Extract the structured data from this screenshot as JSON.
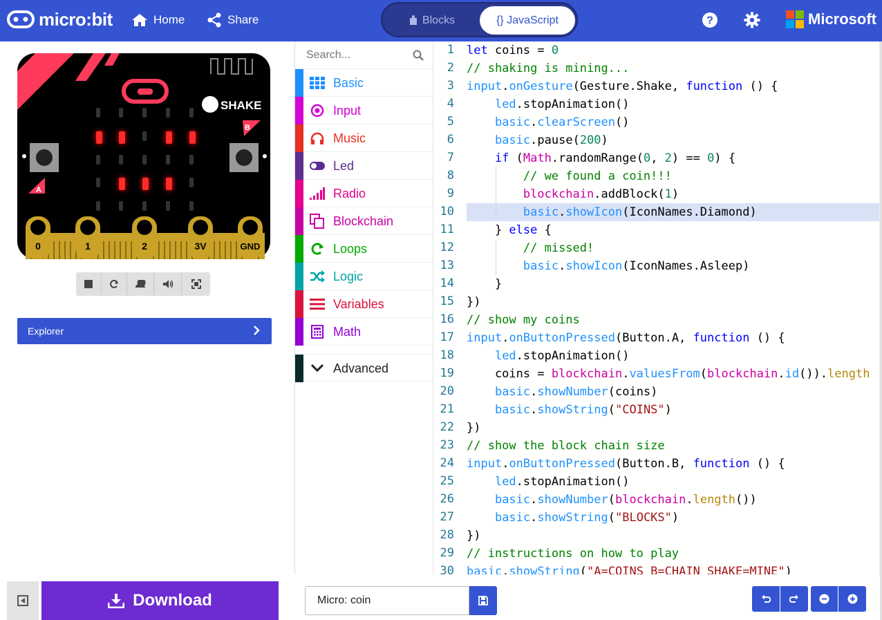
{
  "header": {
    "brand": "micro:bit",
    "home_label": "Home",
    "share_label": "Share",
    "tabs": {
      "blocks": "Blocks",
      "javascript": "{} JavaScript"
    },
    "ms_brand": "Microsoft"
  },
  "simulator": {
    "shake_label": "SHAKE",
    "button_a": "A",
    "button_b": "B",
    "pins": [
      "0",
      "1",
      "2",
      "3V",
      "GND"
    ],
    "explorer_label": "Explorer"
  },
  "toolbox": {
    "search_placeholder": "Search...",
    "categories": [
      {
        "label": "Basic",
        "color": "#1e90ff",
        "icon": "grid-icon"
      },
      {
        "label": "Input",
        "color": "#d400d4",
        "icon": "target-icon"
      },
      {
        "label": "Music",
        "color": "#e63022",
        "icon": "headphones-icon"
      },
      {
        "label": "Led",
        "color": "#5c2d91",
        "icon": "toggle-icon"
      },
      {
        "label": "Radio",
        "color": "#e3008c",
        "icon": "signal-bars-icon"
      },
      {
        "label": "Blockchain",
        "color": "#c800a4",
        "icon": "copy-icon"
      },
      {
        "label": "Loops",
        "color": "#00aa00",
        "icon": "refresh-icon"
      },
      {
        "label": "Logic",
        "color": "#00a4a6",
        "icon": "shuffle-icon"
      },
      {
        "label": "Variables",
        "color": "#dc143c",
        "icon": "list-icon"
      },
      {
        "label": "Math",
        "color": "#9400d3",
        "icon": "calculator-icon"
      }
    ],
    "advanced_label": "Advanced"
  },
  "code": {
    "highlight_line": 10,
    "lines": [
      [
        [
          "let ",
          "kw"
        ],
        [
          "coins ",
          "tx"
        ],
        [
          "= ",
          "tx"
        ],
        [
          "0",
          "num"
        ]
      ],
      [
        [
          "// shaking is mining...",
          "cm"
        ]
      ],
      [
        [
          "input",
          "ns"
        ],
        [
          ".",
          "tx"
        ],
        [
          "onGesture",
          "fn"
        ],
        [
          "(Gesture.Shake, ",
          "tx"
        ],
        [
          "function",
          "kw"
        ],
        [
          " () {",
          "tx"
        ]
      ],
      [
        [
          "    ",
          "tx"
        ],
        [
          "led",
          "ns"
        ],
        [
          ".",
          "tx"
        ],
        [
          "stopAnimation",
          "tx"
        ],
        [
          "()",
          "tx"
        ]
      ],
      [
        [
          "    ",
          "tx"
        ],
        [
          "basic",
          "ns"
        ],
        [
          ".",
          "tx"
        ],
        [
          "clearScreen",
          "fn"
        ],
        [
          "()",
          "tx"
        ]
      ],
      [
        [
          "    ",
          "tx"
        ],
        [
          "basic",
          "ns"
        ],
        [
          ".",
          "tx"
        ],
        [
          "pause",
          "tx"
        ],
        [
          "(",
          "tx"
        ],
        [
          "200",
          "num"
        ],
        [
          ")",
          "tx"
        ]
      ],
      [
        [
          "    ",
          "tx"
        ],
        [
          "if",
          "kw"
        ],
        [
          " (",
          "tx"
        ],
        [
          "Math",
          "cls"
        ],
        [
          ".randomRange(",
          "tx"
        ],
        [
          "0",
          "num"
        ],
        [
          ", ",
          "tx"
        ],
        [
          "2",
          "num"
        ],
        [
          ") == ",
          "tx"
        ],
        [
          "0",
          "num"
        ],
        [
          ") {",
          "tx"
        ]
      ],
      [
        [
          "        ",
          "tx"
        ],
        [
          "// we found a coin!!!",
          "cm"
        ]
      ],
      [
        [
          "        ",
          "tx"
        ],
        [
          "blockchain",
          "cls"
        ],
        [
          ".",
          "tx"
        ],
        [
          "addBlock",
          "tx"
        ],
        [
          "(",
          "tx"
        ],
        [
          "1",
          "num"
        ],
        [
          ")",
          "tx"
        ]
      ],
      [
        [
          "        ",
          "tx"
        ],
        [
          "basic",
          "ns"
        ],
        [
          ".",
          "tx"
        ],
        [
          "showIcon",
          "fn"
        ],
        [
          "(IconNames.Diamond)",
          "tx"
        ]
      ],
      [
        [
          "    } ",
          "tx"
        ],
        [
          "else",
          "kw"
        ],
        [
          " {",
          "tx"
        ]
      ],
      [
        [
          "        ",
          "tx"
        ],
        [
          "// missed!",
          "cm"
        ]
      ],
      [
        [
          "        ",
          "tx"
        ],
        [
          "basic",
          "ns"
        ],
        [
          ".",
          "tx"
        ],
        [
          "showIcon",
          "fn"
        ],
        [
          "(IconNames.Asleep)",
          "tx"
        ]
      ],
      [
        [
          "    }",
          "tx"
        ]
      ],
      [
        [
          "})",
          "tx"
        ]
      ],
      [
        [
          "// show my coins",
          "cm"
        ]
      ],
      [
        [
          "input",
          "ns"
        ],
        [
          ".",
          "tx"
        ],
        [
          "onButtonPressed",
          "fn"
        ],
        [
          "(Button.A, ",
          "tx"
        ],
        [
          "function",
          "kw"
        ],
        [
          " () {",
          "tx"
        ]
      ],
      [
        [
          "    ",
          "tx"
        ],
        [
          "led",
          "ns"
        ],
        [
          ".",
          "tx"
        ],
        [
          "stopAnimation",
          "tx"
        ],
        [
          "()",
          "tx"
        ]
      ],
      [
        [
          "    coins = ",
          "tx"
        ],
        [
          "blockchain",
          "cls"
        ],
        [
          ".",
          "tx"
        ],
        [
          "valuesFrom",
          "fn"
        ],
        [
          "(",
          "tx"
        ],
        [
          "blockchain",
          "cls"
        ],
        [
          ".",
          "tx"
        ],
        [
          "id",
          "fn"
        ],
        [
          "()).",
          "tx"
        ],
        [
          "length",
          "prop"
        ]
      ],
      [
        [
          "    ",
          "tx"
        ],
        [
          "basic",
          "ns"
        ],
        [
          ".",
          "tx"
        ],
        [
          "showNumber",
          "fn"
        ],
        [
          "(coins)",
          "tx"
        ]
      ],
      [
        [
          "    ",
          "tx"
        ],
        [
          "basic",
          "ns"
        ],
        [
          ".",
          "tx"
        ],
        [
          "showString",
          "fn"
        ],
        [
          "(",
          "tx"
        ],
        [
          "\"COINS\"",
          "str"
        ],
        [
          ")",
          "tx"
        ]
      ],
      [
        [
          "})",
          "tx"
        ]
      ],
      [
        [
          "// show the block chain size",
          "cm"
        ]
      ],
      [
        [
          "input",
          "ns"
        ],
        [
          ".",
          "tx"
        ],
        [
          "onButtonPressed",
          "fn"
        ],
        [
          "(Button.B, ",
          "tx"
        ],
        [
          "function",
          "kw"
        ],
        [
          " () {",
          "tx"
        ]
      ],
      [
        [
          "    ",
          "tx"
        ],
        [
          "led",
          "ns"
        ],
        [
          ".",
          "tx"
        ],
        [
          "stopAnimation",
          "tx"
        ],
        [
          "()",
          "tx"
        ]
      ],
      [
        [
          "    ",
          "tx"
        ],
        [
          "basic",
          "ns"
        ],
        [
          ".",
          "tx"
        ],
        [
          "showNumber",
          "fn"
        ],
        [
          "(",
          "tx"
        ],
        [
          "blockchain",
          "cls"
        ],
        [
          ".",
          "tx"
        ],
        [
          "length",
          "prop"
        ],
        [
          "())",
          "tx"
        ]
      ],
      [
        [
          "    ",
          "tx"
        ],
        [
          "basic",
          "ns"
        ],
        [
          ".",
          "tx"
        ],
        [
          "showString",
          "fn"
        ],
        [
          "(",
          "tx"
        ],
        [
          "\"BLOCKS\"",
          "str"
        ],
        [
          ")",
          "tx"
        ]
      ],
      [
        [
          "})",
          "tx"
        ]
      ],
      [
        [
          "// instructions on how to play",
          "cm"
        ]
      ],
      [
        [
          "basic",
          "ns"
        ],
        [
          ".",
          "tx"
        ],
        [
          "showString",
          "fn"
        ],
        [
          "(",
          "tx"
        ],
        [
          "\"A=COINS B=CHAIN SHAKE=MINE\"",
          "str"
        ],
        [
          ")",
          "tx"
        ]
      ]
    ],
    "colors": {
      "kw": "#0000ff",
      "ns": "#1e90ff",
      "fn": "#1e90ff",
      "cls": "#c800a4",
      "num": "#09885a",
      "cm": "#008000",
      "str": "#a31515",
      "prop": "#b8860b",
      "tx": "#000000"
    }
  },
  "footer": {
    "download_label": "Download",
    "project_name": "Micro: coin"
  }
}
